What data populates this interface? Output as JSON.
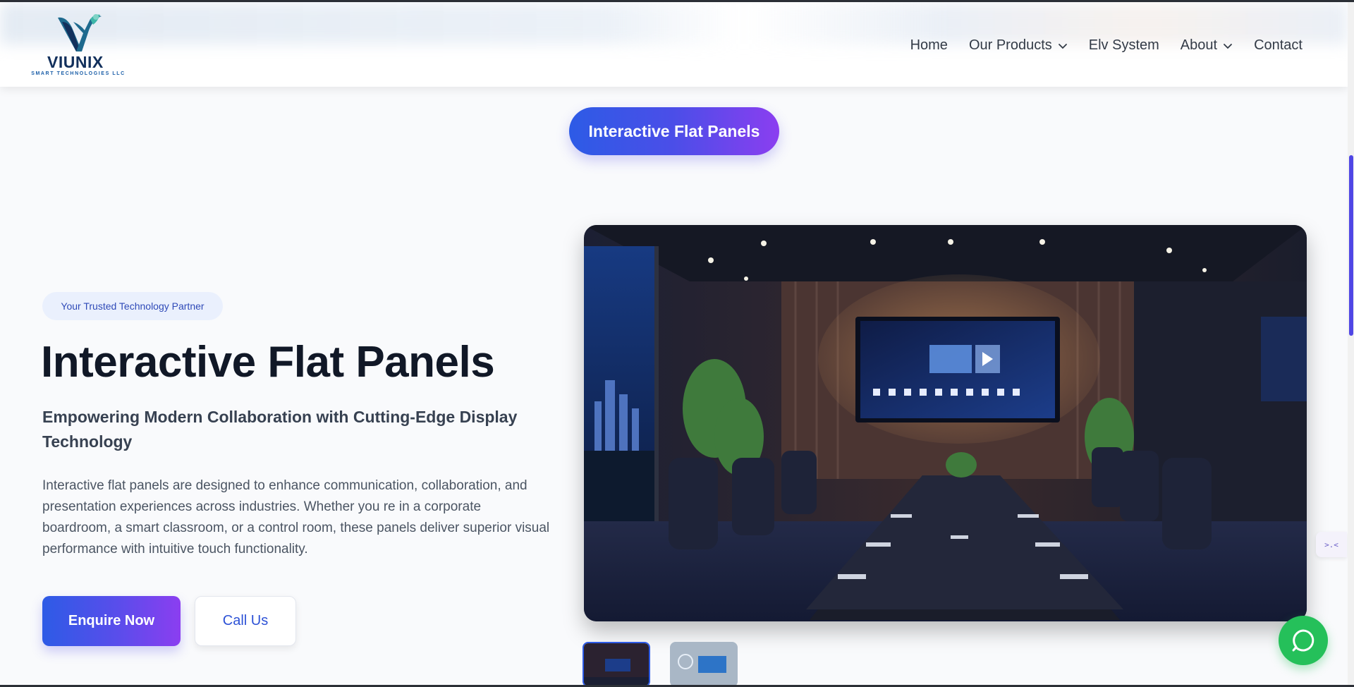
{
  "header": {
    "logo": {
      "name": "VIUNIX",
      "tagline": "SMART TECHNOLOGIES LLC"
    },
    "nav": [
      {
        "label": "Home",
        "dropdown": false
      },
      {
        "label": "Our Products",
        "dropdown": true
      },
      {
        "label": "Elv System",
        "dropdown": false
      },
      {
        "label": "About",
        "dropdown": true
      },
      {
        "label": "Contact",
        "dropdown": false
      }
    ]
  },
  "section": {
    "pill_label": "Interactive Flat Panels"
  },
  "hero": {
    "badge": "Your Trusted Technology Partner",
    "title": "Interactive Flat Panels",
    "subtitle": "Empowering Modern Collaboration with Cutting-Edge Display Technology",
    "description": "Interactive flat panels are designed to enhance communication, collaboration, and presentation experiences across industries. Whether you re in a corporate boardroom, a smart classroom, or a control room, these panels deliver superior visual performance with intuitive touch functionality.",
    "buttons": {
      "primary": "Enquire Now",
      "secondary": "Call Us"
    },
    "image": {
      "subject": "conference-room-with-interactive-panel"
    },
    "thumbnails": [
      {
        "selected": true
      },
      {
        "selected": false
      }
    ]
  },
  "widgets": {
    "chat": "whatsapp-icon",
    "side_widget_text": ">.<"
  },
  "colors": {
    "accent_start": "#2d5be6",
    "accent_end": "#8b3ef0",
    "whatsapp": "#25c05a",
    "heading": "#111827"
  }
}
